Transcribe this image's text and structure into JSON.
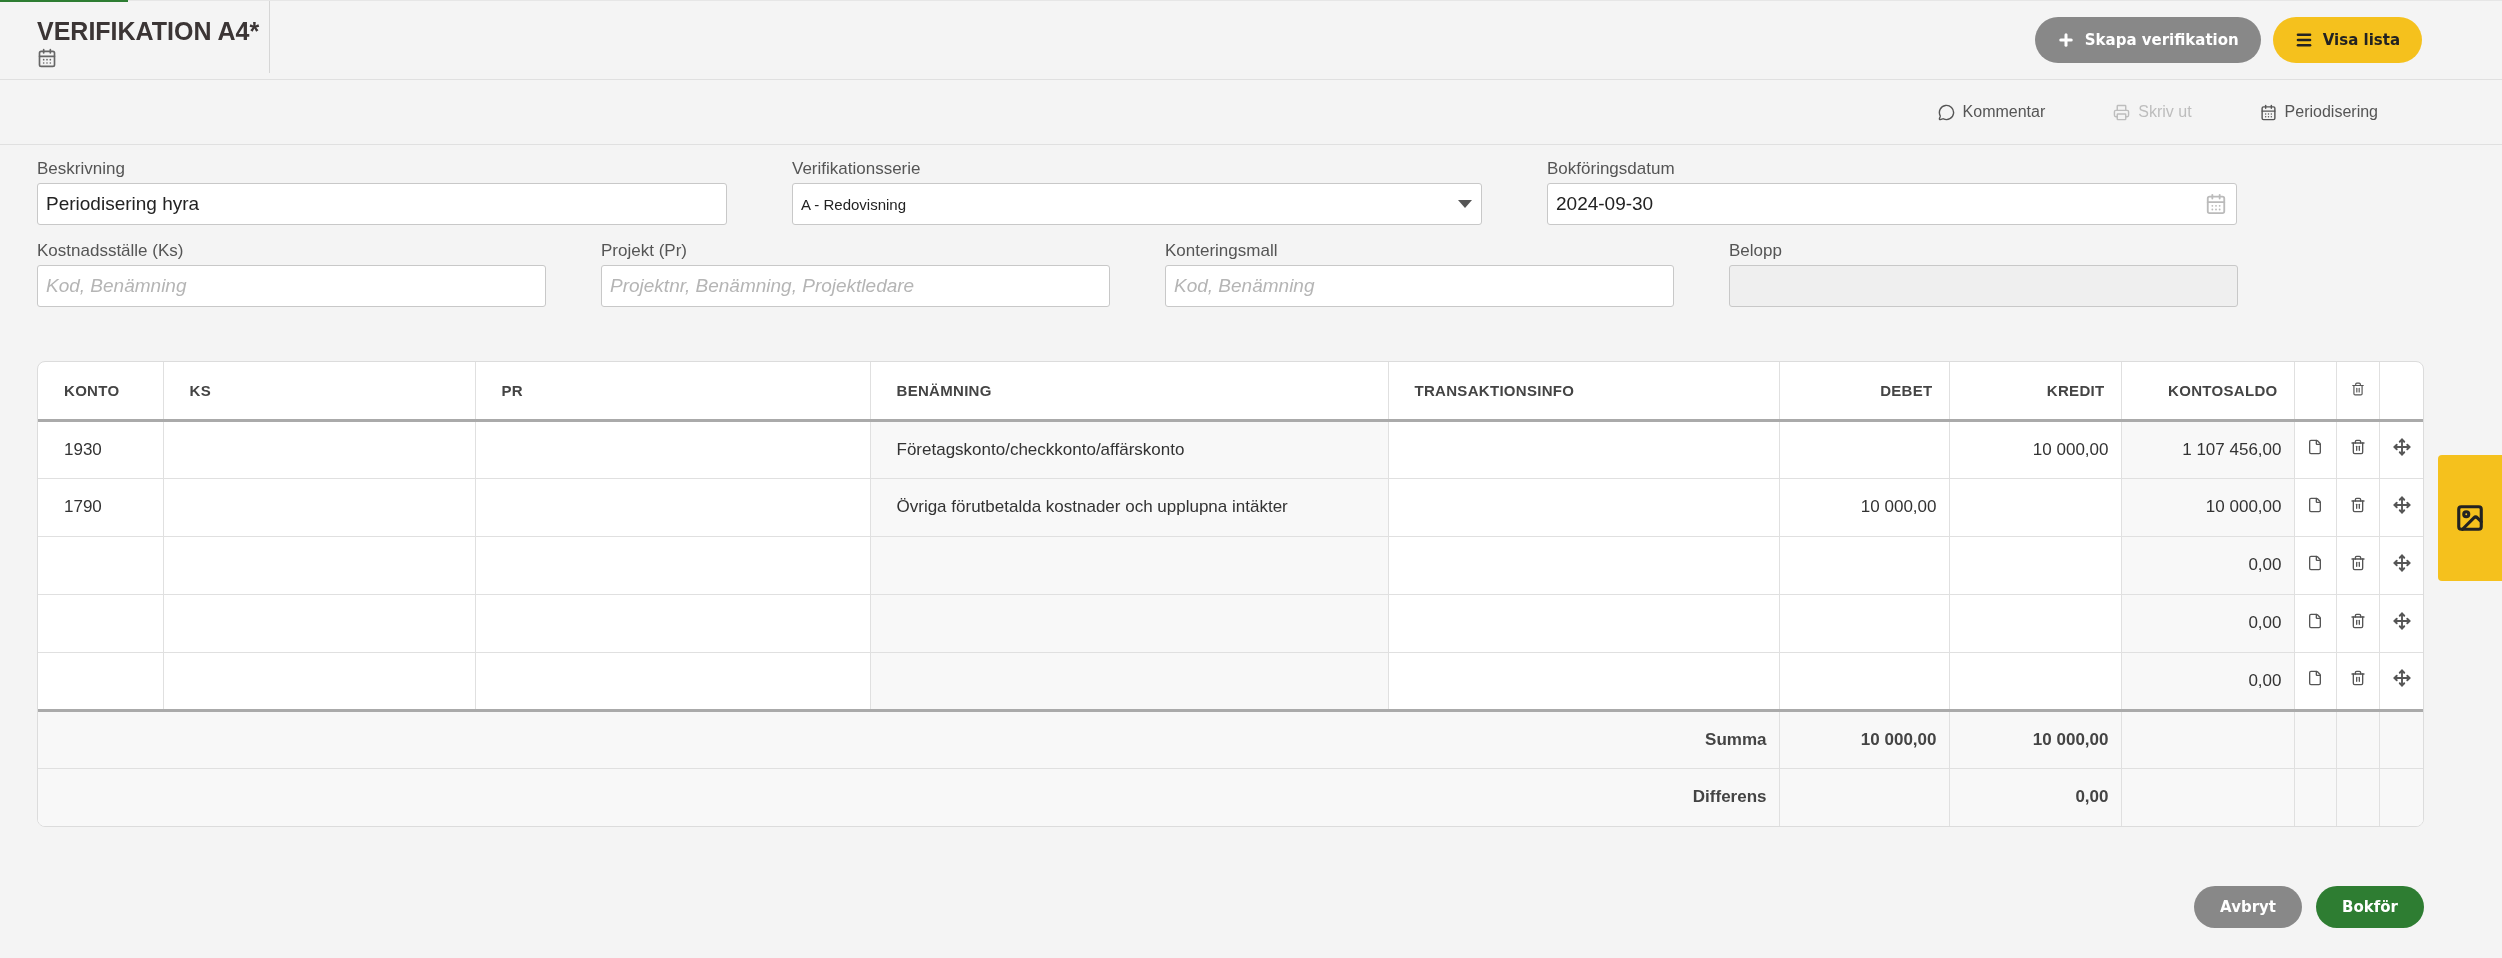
{
  "header": {
    "title": "VERIFIKATION A4*",
    "buttons": [
      {
        "label": "Skapa verifikation",
        "kind": "create"
      },
      {
        "label": "Visa lista",
        "kind": "list"
      }
    ]
  },
  "actions": [
    {
      "label": "Kommentar",
      "kind": "comment",
      "disabled": false
    },
    {
      "label": "Skriv ut",
      "kind": "print",
      "disabled": true
    },
    {
      "label": "Periodisering",
      "kind": "calendar",
      "disabled": false
    }
  ],
  "form": {
    "row_1": [
      {
        "label": "Beskrivning",
        "value": "Periodisering hyra",
        "kind": "text",
        "disabled": false
      },
      {
        "label": "Verifikationsserie",
        "value": "A - Redovisning",
        "kind": "select",
        "disabled": false
      },
      {
        "label": "Bokföringsdatum",
        "value": "2024-09-30",
        "kind": "date",
        "disabled": false
      }
    ],
    "row_2": [
      {
        "label": "Kostnadsställe (Ks)",
        "placeholder": "Kod, Benämning",
        "kind": "text",
        "disabled": false
      },
      {
        "label": "Projekt (Pr)",
        "placeholder": "Projektnr, Benämning, Projektledare",
        "kind": "text",
        "disabled": false
      },
      {
        "label": "Konteringsmall",
        "placeholder": "Kod, Benämning",
        "kind": "text",
        "disabled": false
      },
      {
        "label": "Belopp",
        "kind": "text",
        "disabled": true
      }
    ]
  },
  "table": {
    "columns": [
      "KONTO",
      "KS",
      "PR",
      "BENÄMNING",
      "TRANSAKTIONSINFO",
      "DEBET",
      "KREDIT",
      "KONTOSALDO"
    ],
    "rows": [
      {
        "konto": "1930",
        "benamning": "Företagskonto/checkkonto/affärskonto",
        "kredit": "10 000,00",
        "kontosaldo": "1 107 456,00"
      },
      {
        "konto": "1790",
        "benamning": "Övriga förutbetalda kostnader och upplupna intäkter",
        "debet": "10 000,00",
        "kontosaldo": "10 000,00"
      },
      {
        "kontosaldo": "0,00"
      },
      {
        "kontosaldo": "0,00"
      },
      {
        "kontosaldo": "0,00"
      }
    ],
    "summary": [
      {
        "label": "Summa",
        "debet": "10 000,00",
        "kredit": "10 000,00"
      },
      {
        "label": "Differens",
        "kredit": "0,00"
      }
    ]
  },
  "footer_buttons": [
    {
      "label": "Avbryt",
      "kind": "cancel"
    },
    {
      "label": "Bokför",
      "kind": "submit"
    }
  ]
}
